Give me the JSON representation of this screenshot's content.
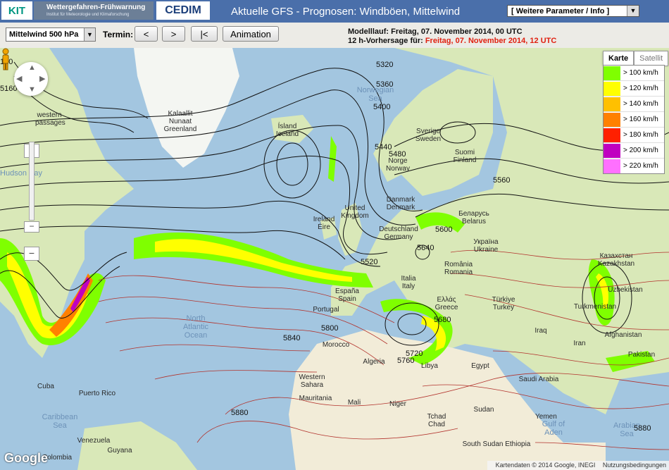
{
  "header": {
    "kit_logo": "KIT",
    "banner_title": "Wettergefahren-Frühwarnung",
    "banner_subtitle": "Institut für Meteorologie und Klimaforschung",
    "cedim_logo": "CEDIM",
    "title": "Aktuelle GFS - Prognosen: Windböen, Mittelwind",
    "param_select": "[ Weitere Parameter / Info ]"
  },
  "toolbar": {
    "level_select": "Mittelwind 500 hPa",
    "termin_label": "Termin:",
    "prev_label": "<",
    "next_label": ">",
    "first_label": "|<",
    "animation_label": "Animation",
    "run_text": "Modelllauf: Freitag, 07. November 2014, 00 UTC",
    "forecast_prefix": "12 h-Vorhersage für: ",
    "forecast_time": "Freitag, 07. November 2014, 12 UTC"
  },
  "map_type": {
    "karte": "Karte",
    "satellit": "Satellit"
  },
  "legend": [
    {
      "label": "> 100 km/h",
      "color": "#7fff00"
    },
    {
      "label": "> 120 km/h",
      "color": "#ffff00"
    },
    {
      "label": "> 140 km/h",
      "color": "#ffc000"
    },
    {
      "label": "> 160 km/h",
      "color": "#ff8000"
    },
    {
      "label": "> 180 km/h",
      "color": "#ff2000"
    },
    {
      "label": "> 200 km/h",
      "color": "#c000c0"
    },
    {
      "label": "> 220 km/h",
      "color": "#ff70ff"
    }
  ],
  "map_labels": {
    "greenland": "Kalaallit\nNunaat\nGreenland",
    "iceland": "Ísland\nIceland",
    "sweden": "Sverige\nSweden",
    "finland": "Suomi\nFinland",
    "norway": "Norge\nNorway",
    "denmark": "Danmark\nDenmark",
    "ireland": "Ireland\nÉire",
    "uk": "United\nKingdom",
    "germany": "Deutschland\nGermany",
    "belarus": "Беларусь\nBelarus",
    "ukraine": "Україна\nUkraine",
    "kazakhstan": "Казахстан\nKazakhstan",
    "romania": "România\nRomania",
    "espana": "España\nSpain",
    "portugal": "Portugal",
    "italia": "Italia\nItaly",
    "greece": "Ελλάς\nGreece",
    "turkiye": "Türkiye\nTurkey",
    "morocco": "Morocco",
    "algeria": "Algeria",
    "libya": "Libya",
    "egypt": "Egypt",
    "iraq": "Iraq",
    "iran": "Iran",
    "saudi": "Saudi Arabia",
    "afghanistan": "Afghanistan",
    "uzbekistan": "Uzbekistan",
    "turkmenistan": "Turkmenistan",
    "pakistan": "Pakistan",
    "mauritania": "Mauritania",
    "western_sahara": "Western\nSahara",
    "mali": "Mali",
    "niger": "Niger",
    "chad": "Tchad\nChad",
    "sudan": "Sudan",
    "ethiopia": "South Sudan Ethiopia",
    "yemen": "Yemen",
    "cuba": "Cuba",
    "puerto_rico": "Puerto Rico",
    "venezuela": "Venezuela",
    "colombia": "Colombia",
    "guyana": "Guyana",
    "western_passages": "western\npassages"
  },
  "ocean_labels": {
    "north_atlantic": "North\nAtlantic\nOcean",
    "hudson_bay": "Hudson Bay",
    "norwegian_sea": "Norwegian Sea",
    "caribbean": "Caribbean Sea",
    "arabian_sea": "Arabian Sea",
    "gulf_of_aden": "Gulf of Aden"
  },
  "contour_labels": [
    "5320",
    "5360",
    "5400",
    "5440",
    "5480",
    "5560",
    "5600",
    "5640",
    "5520",
    "5680",
    "5800",
    "5840",
    "5720",
    "5760",
    "5880",
    "5880",
    "5160",
    "120"
  ],
  "attribution": {
    "data": "Kartendaten © 2014 Google, INEGI",
    "terms": "Nutzungsbedingungen"
  },
  "google_logo": "Google"
}
